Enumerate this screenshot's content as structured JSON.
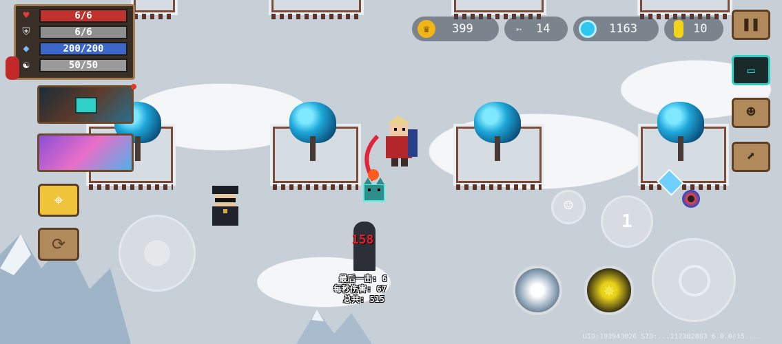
{
  "hud": {
    "hp": {
      "label": "6/6",
      "fraction": 1.0,
      "color": "#c0322e",
      "icon": "heart-icon"
    },
    "armor": {
      "label": "6/6",
      "fraction": 1.0,
      "color": "#8e8e8e",
      "icon": "shield-icon"
    },
    "energy": {
      "label": "200/200",
      "fraction": 1.0,
      "color": "#3b67c9",
      "icon": "crystal-icon"
    },
    "skill": {
      "label": "50/50",
      "fraction": 1.0,
      "color": "#9a9a9a",
      "icon": "yin-yang-icon"
    }
  },
  "currency": {
    "gold": "399",
    "fish": "14",
    "gems": "1163",
    "coins": "10"
  },
  "dummy": {
    "damage": "158",
    "last_hit": "最后一击: 6",
    "dps": "每秒伤害: 67",
    "total": "总共: 515"
  },
  "weapon_slot_label": "1",
  "footer_id": "UID:193943026 SID:...112382883 6.0.0(15..."
}
